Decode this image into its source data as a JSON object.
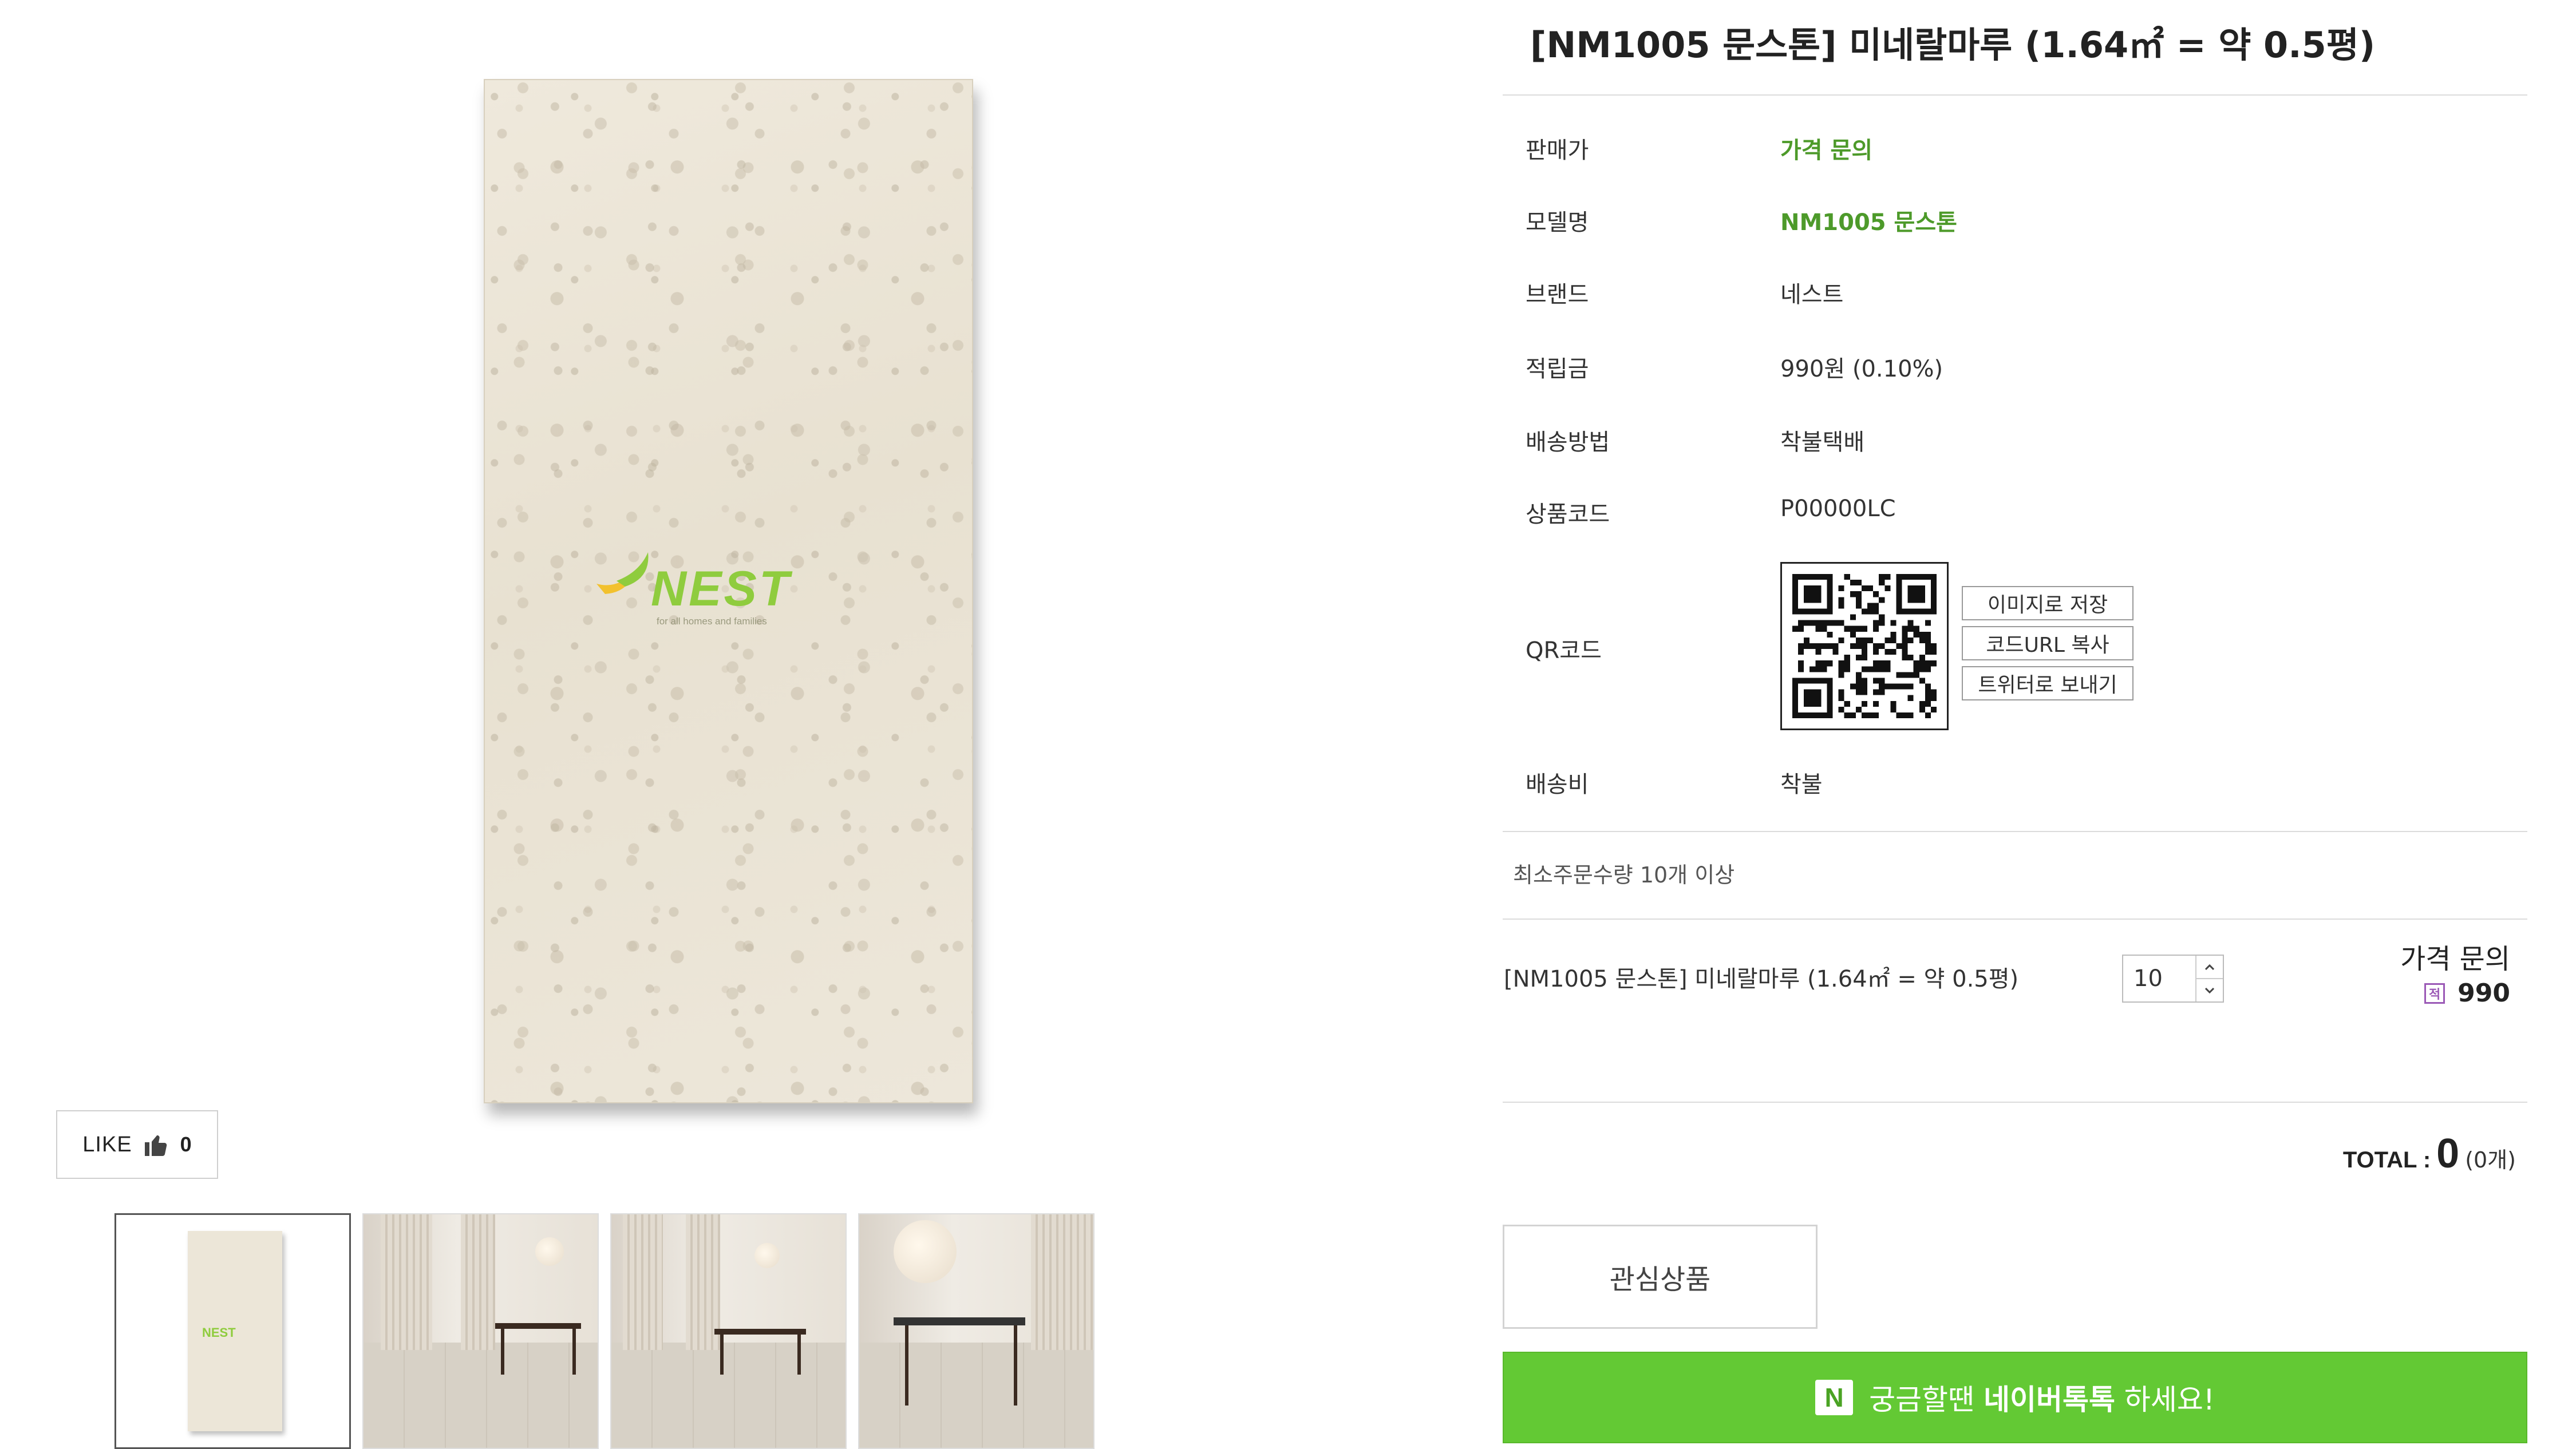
{
  "product": {
    "title": "[NM1005 문스톤] 미네랄마루 (1.64㎡ = 약 0.5평)"
  },
  "gallery": {
    "brand_logo_text": "NEST",
    "brand_logo_tagline": "for all homes and families",
    "like_label": "LIKE",
    "like_count": "0",
    "thumbnail_logo": "NEST"
  },
  "specs": [
    {
      "label": "판매가",
      "value": "가격 문의"
    },
    {
      "label": "모델명",
      "value": "NM1005 문스톤"
    },
    {
      "label": "브랜드",
      "value": "네스트"
    },
    {
      "label": "적립금",
      "value": "990원 (0.10%)"
    },
    {
      "label": "배송방법",
      "value": "착불택배"
    },
    {
      "label": "상품코드",
      "value": "P00000LC"
    },
    {
      "label": "QR코드",
      "value": ""
    },
    {
      "label": "배송비",
      "value": "착불"
    }
  ],
  "qr_buttons": {
    "save_image": "이미지로 저장",
    "copy_url": "코드URL 복사",
    "send_twitter": "트위터로 보내기"
  },
  "order": {
    "min_qty_text": "최소주문수량 10개 이상",
    "option_name": "[NM1005 문스톤] 미네랄마루 (1.64㎡ = 약 0.5평)",
    "quantity": "10",
    "option_price": "가격 문의",
    "option_mileage": "990",
    "mileage_icon": "적"
  },
  "total": {
    "label": "TOTAL :",
    "amount": "0",
    "count": "(0개)"
  },
  "actions": {
    "wishlist_label": "관심상품",
    "talk_prefix": "궁금할땐",
    "talk_strong": "네이버톡톡",
    "talk_suffix": "하세요!",
    "talk_icon_letter": "N"
  },
  "colors": {
    "accent_green": "#4d9a2a",
    "talk_button": "#63c934",
    "mileage_icon": "#9b59b6"
  }
}
